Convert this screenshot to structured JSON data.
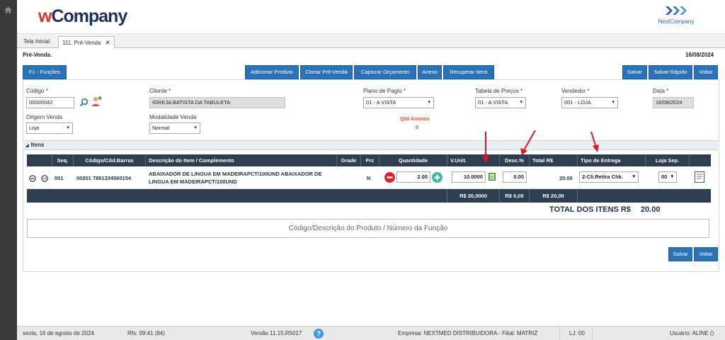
{
  "header": {
    "logo_w": "w",
    "logo_rest": "Company",
    "brand_right": "NextCompany"
  },
  "tabs": [
    {
      "label": "Tela Inicial"
    },
    {
      "label": "111. Pré-Venda"
    }
  ],
  "page": {
    "title": "Pré-Venda.",
    "date": "16/08/2024"
  },
  "toolbar": {
    "functions": "F1 - Funções",
    "add_product": "Adicionar Produto",
    "clone": "Clonar Pré-Venda",
    "capture": "Capturar Orçamento",
    "attachment": "Anexo",
    "recover": "Recuperar Itens",
    "save": "Salvar",
    "quick_save": "Salvar Rápido",
    "back": "Voltar"
  },
  "form": {
    "codigo_label": "Código *",
    "codigo_value": "00000042",
    "cliente_label": "Cliente *",
    "cliente_value": "IGREJA BATISTA DA TABULETA",
    "plano_label": "Plano de Pagto *",
    "plano_value": "01 - A VISTA",
    "tabela_label": "Tabela de Preços *",
    "tabela_value": "01 - A VISTA",
    "vendedor_label": "Vendedor *",
    "vendedor_value": "001 - LOJA",
    "data_label": "Data *",
    "data_value": "16/08/2024",
    "origem_label": "Origem Venda",
    "origem_value": "Loja",
    "modalidade_label": "Modalidade Venda",
    "modalidade_value": "Normal",
    "anexos_label": "Qtd Anexos",
    "anexos_value": "0"
  },
  "items": {
    "section_title": "Itens",
    "columns": [
      "Seq.",
      "Código/Cód.Barras",
      "Descrição do Item / Complemento",
      "Grade",
      "Frc",
      "Quantidade",
      "V.Unit.",
      "Desc.%",
      "Total R$",
      "Tipo de Entrega",
      "Loja Sep."
    ],
    "row": {
      "seq": "001",
      "codigo": "00201 7891334560154",
      "descricao": "ABAIXADOR DE LINGUA EM MADEIRAPCT/100UND ABAIXADOR DE LINGUA EM MADEIRAPCT/100UND",
      "frc": "N",
      "quantidade": "2.00",
      "vunit": "10.0000",
      "desc": "0.00",
      "total": "20.00",
      "entrega": "2-Cli.Retira Chk.",
      "loja": "00"
    },
    "totals": {
      "vunit": "R$ 20,0000",
      "desc": "R$ 0,00",
      "total": "R$ 20,00"
    },
    "total_label": "TOTAL DOS ITENS R$",
    "total_value": "20.00",
    "search_placeholder": "Código/Descrição do Produto / Número da Função"
  },
  "bottom_buttons": {
    "save": "Salvar",
    "back": "Voltar"
  },
  "footer": {
    "date": "sexta, 16 de agosto de 2024",
    "rfs": "Rfs: 09:41 (84)",
    "version": "Versão 11.15.R5017",
    "empresa": "Empresa: NEXTMED DISTRIBUIDORA - Filial: MATRIZ",
    "lj": "LJ: 00",
    "usuario": "Usuário: ALINE ()"
  },
  "colors": {
    "primary_button": "#2a73b8",
    "table_header": "#2e3e51",
    "accent_red": "#e0312a",
    "anexos": "#e8531f"
  }
}
